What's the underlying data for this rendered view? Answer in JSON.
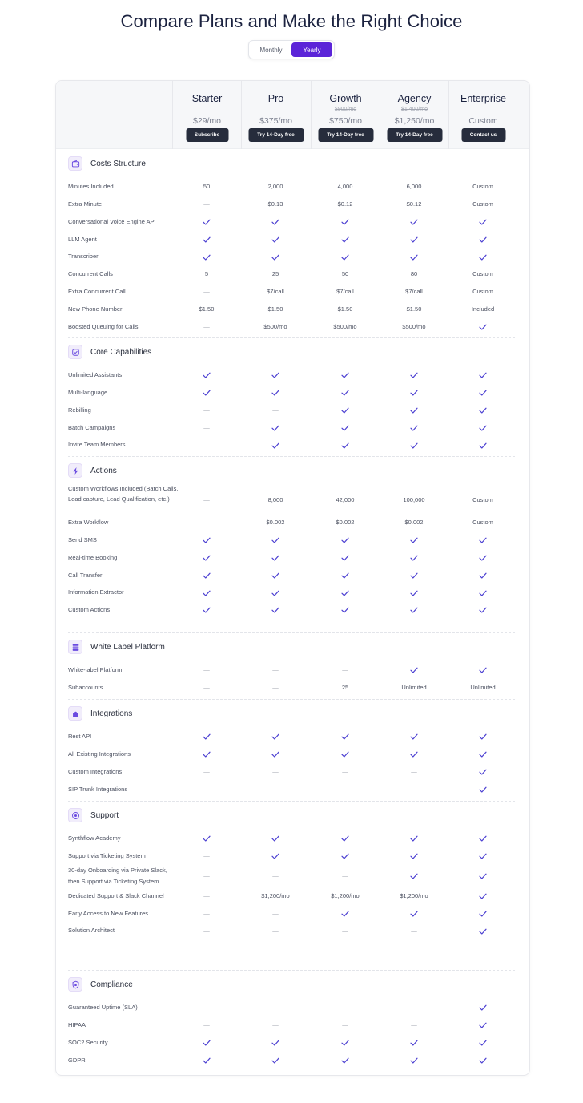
{
  "title": "Compare Plans and Make the Right Choice",
  "billing_toggle": {
    "monthly": "Monthly",
    "yearly": "Yearly",
    "selected": "Yearly"
  },
  "colors": {
    "accent": "#5b24d8",
    "check": "#4b3fd1",
    "button": "#262c3c"
  },
  "plans": [
    {
      "name": "Starter",
      "old_price": "",
      "price": "$29/mo",
      "button": "Subscribe"
    },
    {
      "name": "Pro",
      "old_price": "",
      "price": "$375/mo",
      "button": "Try 14-Day free"
    },
    {
      "name": "Growth",
      "old_price": "$900/mo",
      "price": "$750/mo",
      "button": "Try 14-Day free"
    },
    {
      "name": "Agency",
      "old_price": "$1,400/mo",
      "price": "$1,250/mo",
      "button": "Try 14-Day free"
    },
    {
      "name": "Enterprise",
      "old_price": "",
      "price": "Custom",
      "button": "Contact us"
    }
  ],
  "sections": [
    {
      "title": "Costs Structure",
      "icon": "wallet-icon",
      "rows": [
        {
          "feature": "Minutes Included",
          "values": [
            "50",
            "2,000",
            "4,000",
            "6,000",
            "Custom"
          ]
        },
        {
          "feature": "Extra Minute",
          "values": [
            "—",
            "$0.13",
            "$0.12",
            "$0.12",
            "Custom"
          ]
        },
        {
          "feature": "Conversational Voice Engine API",
          "values": [
            "check",
            "check",
            "check",
            "check",
            "check"
          ]
        },
        {
          "feature": "LLM Agent",
          "values": [
            "check",
            "check",
            "check",
            "check",
            "check"
          ]
        },
        {
          "feature": "Transcriber",
          "values": [
            "check",
            "check",
            "check",
            "check",
            "check"
          ]
        },
        {
          "feature": "Concurrent Calls",
          "values": [
            "5",
            "25",
            "50",
            "80",
            "Custom"
          ]
        },
        {
          "feature": "Extra Concurrent Call",
          "values": [
            "—",
            "$7/call",
            "$7/call",
            "$7/call",
            "Custom"
          ]
        },
        {
          "feature": "New Phone Number",
          "values": [
            "$1.50",
            "$1.50",
            "$1.50",
            "$1.50",
            "Included"
          ]
        },
        {
          "feature": "Boosted Queuing for Calls",
          "values": [
            "—",
            "$500/mo",
            "$500/mo",
            "$500/mo",
            "check"
          ]
        }
      ]
    },
    {
      "title": "Core Capabilities",
      "icon": "badge-check-icon",
      "rows": [
        {
          "feature": "Unlimited Assistants",
          "values": [
            "check",
            "check",
            "check",
            "check",
            "check"
          ]
        },
        {
          "feature": "Multi-language",
          "values": [
            "check",
            "check",
            "check",
            "check",
            "check"
          ]
        },
        {
          "feature": "Rebilling",
          "values": [
            "—",
            "—",
            "check",
            "check",
            "check"
          ]
        },
        {
          "feature": "Batch Campaigns",
          "values": [
            "—",
            "check",
            "check",
            "check",
            "check"
          ]
        },
        {
          "feature": "Invite Team Members",
          "values": [
            "—",
            "check",
            "check",
            "check",
            "check"
          ]
        }
      ]
    },
    {
      "title": "Actions",
      "icon": "lightning-icon",
      "rows": [
        {
          "feature": "Custom Workflows Included (Batch Calls, Lead capture, Lead Qualification, etc.)",
          "values": [
            "—",
            "8,000",
            "42,000",
            "100,000",
            "Custom"
          ]
        },
        {
          "feature": "Extra Workflow",
          "values": [
            "—",
            "$0.002",
            "$0.002",
            "$0.002",
            "Custom"
          ]
        },
        {
          "feature": "Send SMS",
          "values": [
            "check",
            "check",
            "check",
            "check",
            "check"
          ]
        },
        {
          "feature": "Real-time Booking",
          "values": [
            "check",
            "check",
            "check",
            "check",
            "check"
          ]
        },
        {
          "feature": "Call Transfer",
          "values": [
            "check",
            "check",
            "check",
            "check",
            "check"
          ]
        },
        {
          "feature": "Information Extractor",
          "values": [
            "check",
            "check",
            "check",
            "check",
            "check"
          ]
        },
        {
          "feature": "Custom Actions",
          "values": [
            "check",
            "check",
            "check",
            "check",
            "check"
          ]
        }
      ]
    },
    {
      "title": "White Label Platform",
      "icon": "server-icon",
      "rows": [
        {
          "feature": "White-label Platform",
          "values": [
            "—",
            "—",
            "—",
            "check",
            "check"
          ]
        },
        {
          "feature": "Subaccounts",
          "values": [
            "—",
            "—",
            "25",
            "Unlimited",
            "Unlimited"
          ]
        }
      ]
    },
    {
      "title": "Integrations",
      "icon": "puzzle-icon",
      "rows": [
        {
          "feature": "Rest API",
          "values": [
            "check",
            "check",
            "check",
            "check",
            "check"
          ]
        },
        {
          "feature": "All Existing Integrations",
          "values": [
            "check",
            "check",
            "check",
            "check",
            "check"
          ]
        },
        {
          "feature": "Custom Integrations",
          "values": [
            "—",
            "—",
            "—",
            "—",
            "check"
          ]
        },
        {
          "feature": "SIP Trunk Integrations",
          "values": [
            "—",
            "—",
            "—",
            "—",
            "check"
          ]
        }
      ]
    },
    {
      "title": "Support",
      "icon": "help-circle-icon",
      "rows": [
        {
          "feature": "Synthflow Academy",
          "values": [
            "check",
            "check",
            "check",
            "check",
            "check"
          ]
        },
        {
          "feature": "Support via Ticketing System",
          "values": [
            "—",
            "check",
            "check",
            "check",
            "check"
          ]
        },
        {
          "feature": "30-day Onboarding via Private Slack, then Support via Ticketing System",
          "values": [
            "—",
            "—",
            "—",
            "check",
            "check"
          ]
        },
        {
          "feature": "Dedicated Support & Slack Channel",
          "values": [
            "—",
            "$1,200/mo",
            "$1,200/mo",
            "$1,200/mo",
            "check"
          ]
        },
        {
          "feature": "Early Access to New Features",
          "values": [
            "—",
            "—",
            "check",
            "check",
            "check"
          ]
        },
        {
          "feature": "Solution Architect",
          "values": [
            "—",
            "—",
            "—",
            "—",
            "check"
          ]
        }
      ]
    },
    {
      "title": "Compliance",
      "icon": "shield-lock-icon",
      "rows": [
        {
          "feature": "Guaranteed Uptime (SLA)",
          "values": [
            "—",
            "—",
            "—",
            "—",
            "check"
          ]
        },
        {
          "feature": "HIPAA",
          "values": [
            "—",
            "—",
            "—",
            "—",
            "check"
          ]
        },
        {
          "feature": "SOC2 Security",
          "values": [
            "check",
            "check",
            "check",
            "check",
            "check"
          ]
        },
        {
          "feature": "GDPR",
          "values": [
            "check",
            "check",
            "check",
            "check",
            "check"
          ]
        }
      ]
    }
  ]
}
